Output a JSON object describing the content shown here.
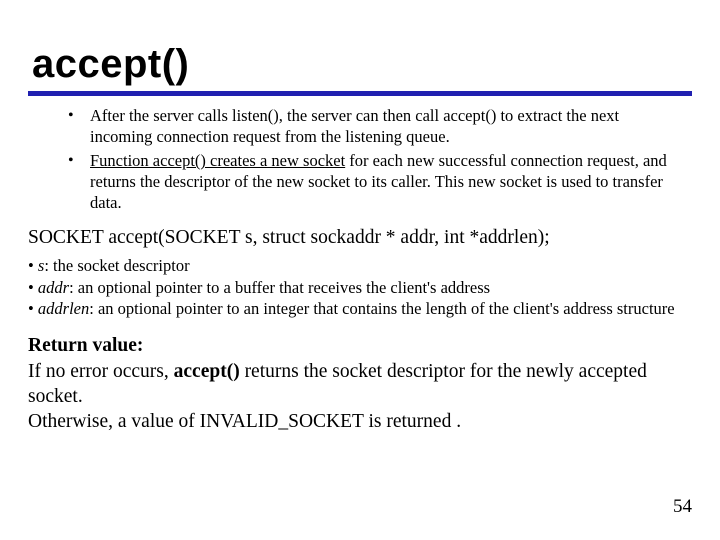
{
  "title": "accept()",
  "bullets": {
    "b1": "After the server calls listen(), the server can then call accept() to extract the next incoming connection request from the listening queue.",
    "b2_u": "Function accept() creates a new socket",
    "b2_rest": " for each new successful connection request, and returns the descriptor of the new socket to its caller. This new socket is used to transfer data."
  },
  "signature": "SOCKET accept(SOCKET s, struct sockaddr * addr, int *addrlen);",
  "params": {
    "p1_name": "s",
    "p1_desc": ": the socket descriptor",
    "p2_name": "addr",
    "p2_desc": ": an optional pointer to a buffer that receives the client's address",
    "p3_name": "addrlen",
    "p3_desc": ": an optional pointer to an integer that contains the length of the client's address structure"
  },
  "return": {
    "label": "Return value:",
    "line2_a": "If no error occurs, ",
    "line2_b": "accept()",
    "line2_c": " returns the socket descriptor for the newly accepted socket.",
    "line3": "Otherwise, a value of INVALID_SOCKET is returned ."
  },
  "page_number": "54"
}
